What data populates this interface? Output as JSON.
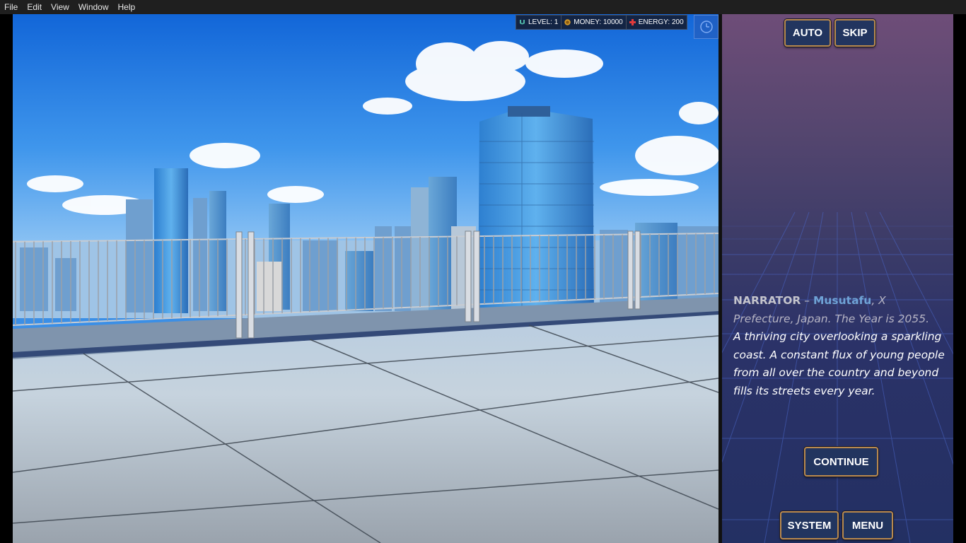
{
  "menubar": {
    "items": [
      "File",
      "Edit",
      "View",
      "Window",
      "Help"
    ]
  },
  "hud": {
    "level": "LEVEL: 1",
    "money": "MONEY: 10000",
    "energy": "ENERGY: 200"
  },
  "buttons": {
    "auto": "AUTO",
    "skip": "SKIP",
    "continue": "CONTINUE",
    "system": "SYSTEM",
    "menu": "MENU"
  },
  "dialogue": {
    "speaker": "NARRATOR",
    "separator": "–",
    "place": "Musutafu",
    "place_rest": ", X Prefecture, Japan. The Year is 2055.",
    "body": "A thriving city overlooking a sparkling coast. A constant flux of young people from all over the country and beyond fills its streets every year."
  },
  "colors": {
    "button_bg": "#22355f",
    "button_border": "#b8894e",
    "place_highlight": "#6fa3d6",
    "panel_top": "#6e4d78",
    "panel_bottom": "#233063"
  }
}
